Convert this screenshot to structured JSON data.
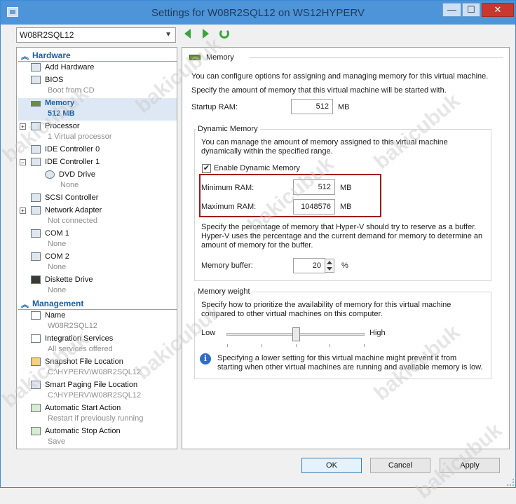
{
  "window": {
    "title": "Settings for W08R2SQL12 on WS12HYPERV",
    "minimize": "—",
    "maximize": "☐",
    "close": "✕"
  },
  "vm_selector": {
    "value": "W08R2SQL12"
  },
  "sidebar": {
    "hardware_header": "Hardware",
    "management_header": "Management",
    "hardware_items": [
      {
        "label": "Add Hardware",
        "sub": ""
      },
      {
        "label": "BIOS",
        "sub": "Boot from CD"
      },
      {
        "label": "Memory",
        "sub": "512 MB"
      },
      {
        "label": "Processor",
        "sub": "1 Virtual processor"
      },
      {
        "label": "IDE Controller 0",
        "sub": ""
      },
      {
        "label": "IDE Controller 1",
        "sub": ""
      },
      {
        "label": "DVD Drive",
        "sub": "None"
      },
      {
        "label": "SCSI Controller",
        "sub": ""
      },
      {
        "label": "Network Adapter",
        "sub": "Not connected"
      },
      {
        "label": "COM 1",
        "sub": "None"
      },
      {
        "label": "COM 2",
        "sub": "None"
      },
      {
        "label": "Diskette Drive",
        "sub": "None"
      }
    ],
    "management_items": [
      {
        "label": "Name",
        "sub": "W08R2SQL12"
      },
      {
        "label": "Integration Services",
        "sub": "All services offered"
      },
      {
        "label": "Snapshot File Location",
        "sub": "C:\\HYPERV\\W08R2SQL12"
      },
      {
        "label": "Smart Paging File Location",
        "sub": "C:\\HYPERV\\W08R2SQL12"
      },
      {
        "label": "Automatic Start Action",
        "sub": "Restart if previously running"
      },
      {
        "label": "Automatic Stop Action",
        "sub": "Save"
      }
    ]
  },
  "memory_panel": {
    "header": "Memory",
    "intro1": "You can configure options for assigning and managing memory for this virtual machine.",
    "intro2": "Specify the amount of memory that this virtual machine will be started with.",
    "startup_label": "Startup RAM:",
    "startup_value": "512",
    "unit_mb": "MB",
    "dynamic": {
      "title": "Dynamic Memory",
      "desc1": "You can manage the amount of memory assigned to this virtual machine",
      "desc2": "dynamically within the specified range.",
      "enable_label": "Enable Dynamic Memory",
      "enable_checked": "✔",
      "min_label": "Minimum RAM:",
      "min_value": "512",
      "max_label": "Maximum RAM:",
      "max_value": "1048576",
      "buffer_desc1": "Specify the percentage of memory that Hyper-V should try to reserve as a buffer.",
      "buffer_desc2": "Hyper-V uses the percentage and the current demand for memory to determine an",
      "buffer_desc3": "amount of memory for the buffer.",
      "buffer_label": "Memory buffer:",
      "buffer_value": "20",
      "buffer_unit": "%"
    },
    "weight": {
      "title": "Memory weight",
      "desc1": "Specify how to prioritize the availability of memory for this virtual machine",
      "desc2": "compared to other virtual machines on this computer.",
      "low": "Low",
      "high": "High",
      "slider_level": 0.5,
      "info1": "Specifying a lower setting for this virtual machine might prevent it from",
      "info2": "starting when other virtual machines are running and available memory is low."
    }
  },
  "buttons": {
    "ok": "OK",
    "cancel": "Cancel",
    "apply": "Apply"
  },
  "watermark": "bakicubuk"
}
